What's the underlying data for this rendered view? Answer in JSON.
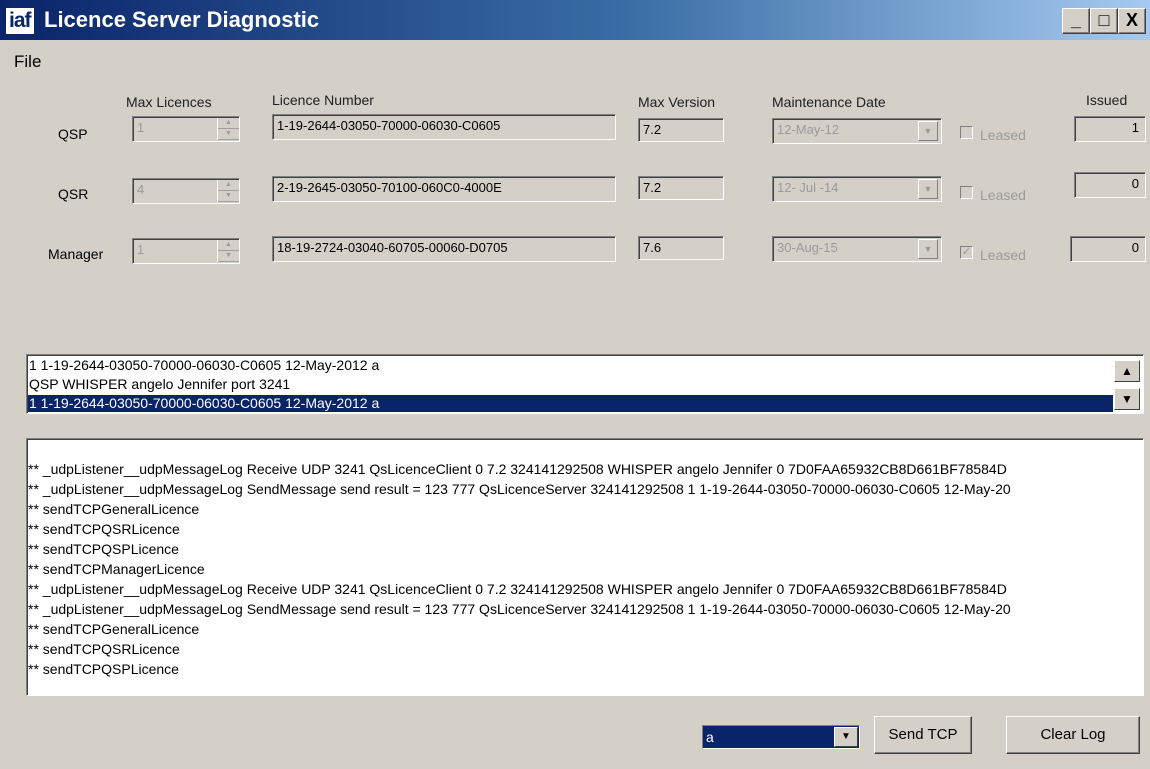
{
  "window": {
    "logo": "iaf",
    "title": "Licence Server Diagnostic",
    "minimize": "_",
    "maximize": "□",
    "close": "X"
  },
  "menu": {
    "file": "File"
  },
  "headers": {
    "max_licences": "Max Licences",
    "licence_number": "Licence Number",
    "max_version": "Max Version",
    "maintenance_date": "Maintenance Date",
    "issued": "Issued"
  },
  "rows": [
    {
      "label": "QSP",
      "max_licences": "1",
      "licence_number": "1-19-2644-03050-70000-06030-C0605",
      "max_version": "7.2",
      "maintenance_date": "12-May-12",
      "leased_label": "Leased",
      "leased": false,
      "issued": "1"
    },
    {
      "label": "QSR",
      "max_licences": "4",
      "licence_number": "2-19-2645-03050-70100-060C0-4000E",
      "max_version": "7.2",
      "maintenance_date": "12- Jul -14",
      "leased_label": "Leased",
      "leased": false,
      "issued": "0"
    },
    {
      "label": "Manager",
      "max_licences": "1",
      "licence_number": "18-19-2724-03040-60705-00060-D0705",
      "max_version": "7.6",
      "maintenance_date": "30-Aug-15",
      "leased_label": "Leased",
      "leased": true,
      "issued": "0"
    }
  ],
  "listbox": {
    "items": [
      "1 1-19-2644-03050-70000-06030-C0605 12-May-2012 a",
      "QSP WHISPER angelo Jennifer port 3241",
      "1 1-19-2644-03050-70000-06030-C0605 12-May-2012 a"
    ],
    "selected_index": 2
  },
  "log": {
    "lines": [
      "** _udpListener__udpMessageLog Receive UDP 3241 QsLicenceClient 0 7.2 324141292508 WHISPER angelo Jennifer 0 7D0FAA65932CB8D661BF78584D",
      "** _udpListener__udpMessageLog SendMessage send result = 123 777 QsLicenceServer 324141292508 1 1-19-2644-03050-70000-06030-C0605 12-May-20",
      "** sendTCPGeneralLicence",
      "** sendTCPQSRLicence",
      "** sendTCPQSPLicence",
      "** sendTCPManagerLicence",
      "** _udpListener__udpMessageLog Receive UDP 3241 QsLicenceClient 0 7.2 324141292508 WHISPER angelo Jennifer 0 7D0FAA65932CB8D661BF78584D",
      "** _udpListener__udpMessageLog SendMessage send result = 123 777 QsLicenceServer 324141292508 1 1-19-2644-03050-70000-06030-C0605 12-May-20",
      "** sendTCPGeneralLicence",
      "** sendTCPQSRLicence",
      "** sendTCPQSPLicence"
    ]
  },
  "bottom": {
    "combo_value": "a",
    "send_tcp": "Send TCP",
    "clear_log": "Clear Log"
  },
  "icons": {
    "spin": "spinner-updown-icon",
    "dropdown": "chevron-down-icon",
    "scroll_up": "scroll-up-arrow-icon",
    "scroll_down": "scroll-down-arrow-icon",
    "check": "checkmark-icon"
  },
  "colors": {
    "selection": "#0a246a",
    "titlebar_start": "#0a246a",
    "titlebar_end": "#a6caf0",
    "face": "#d4d0c8"
  }
}
